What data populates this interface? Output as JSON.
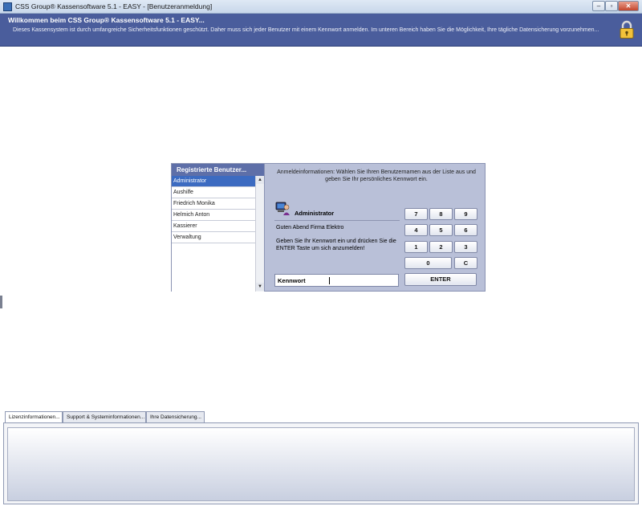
{
  "window": {
    "title": "CSS Group® Kassensoftware 5.1 - EASY - [Benutzeranmeldung]",
    "minimize_glyph": "‒",
    "maximize_glyph": "▫",
    "close_glyph": "✕"
  },
  "banner": {
    "title": "Willkommen beim CSS Group® Kassensoftware 5.1 - EASY...",
    "subtitle": "Dieses Kassensystem ist durch umfangreiche Sicherheitsfunktionen geschützt. Daher muss sich jeder Benutzer mit einem Kennwort anmelden. Im unteren Bereich haben Sie die Möglichkeit, Ihre tägliche Datensicherung vorzunehmen...",
    "icon": "padlock-icon"
  },
  "users": {
    "header": "Registrierte Benutzer...",
    "items": [
      {
        "label": "Administrator",
        "selected": true
      },
      {
        "label": "Aushilfe",
        "selected": false
      },
      {
        "label": "Friedrich Monika",
        "selected": false
      },
      {
        "label": "Helmich Anton",
        "selected": false
      },
      {
        "label": "Kassierer",
        "selected": false
      },
      {
        "label": "Verwaltung",
        "selected": false
      }
    ],
    "scroll_up": "▲",
    "scroll_down": "▼"
  },
  "login": {
    "info": "Anmeldeinformationen: Wählen Sie Ihren Benutzernamen aus der Liste aus und geben Sie Ihr persönliches Kennwort ein.",
    "selected_user": "Administrator",
    "greeting": "Guten Abend Firma Elektro",
    "instruction": "Geben Sie Ihr Kennwort ein und drücken Sie die ENTER Taste um sich anzumelden!",
    "password_label": "Kennwort",
    "password_value": ""
  },
  "keypad": {
    "k7": "7",
    "k8": "8",
    "k9": "9",
    "k4": "4",
    "k5": "5",
    "k6": "6",
    "k1": "1",
    "k2": "2",
    "k3": "3",
    "k0": "0",
    "clear": "C",
    "enter": "ENTER"
  },
  "tabs": [
    {
      "label": "Lizenzinformationen...",
      "active": true
    },
    {
      "label": "Support & Systeminformationen...",
      "active": false
    },
    {
      "label": "Ihre Datensicherung...",
      "active": false
    }
  ],
  "colors": {
    "banner": "#4a5d9c",
    "panel": "#b9c0d8",
    "selection": "#3c6bc1"
  }
}
